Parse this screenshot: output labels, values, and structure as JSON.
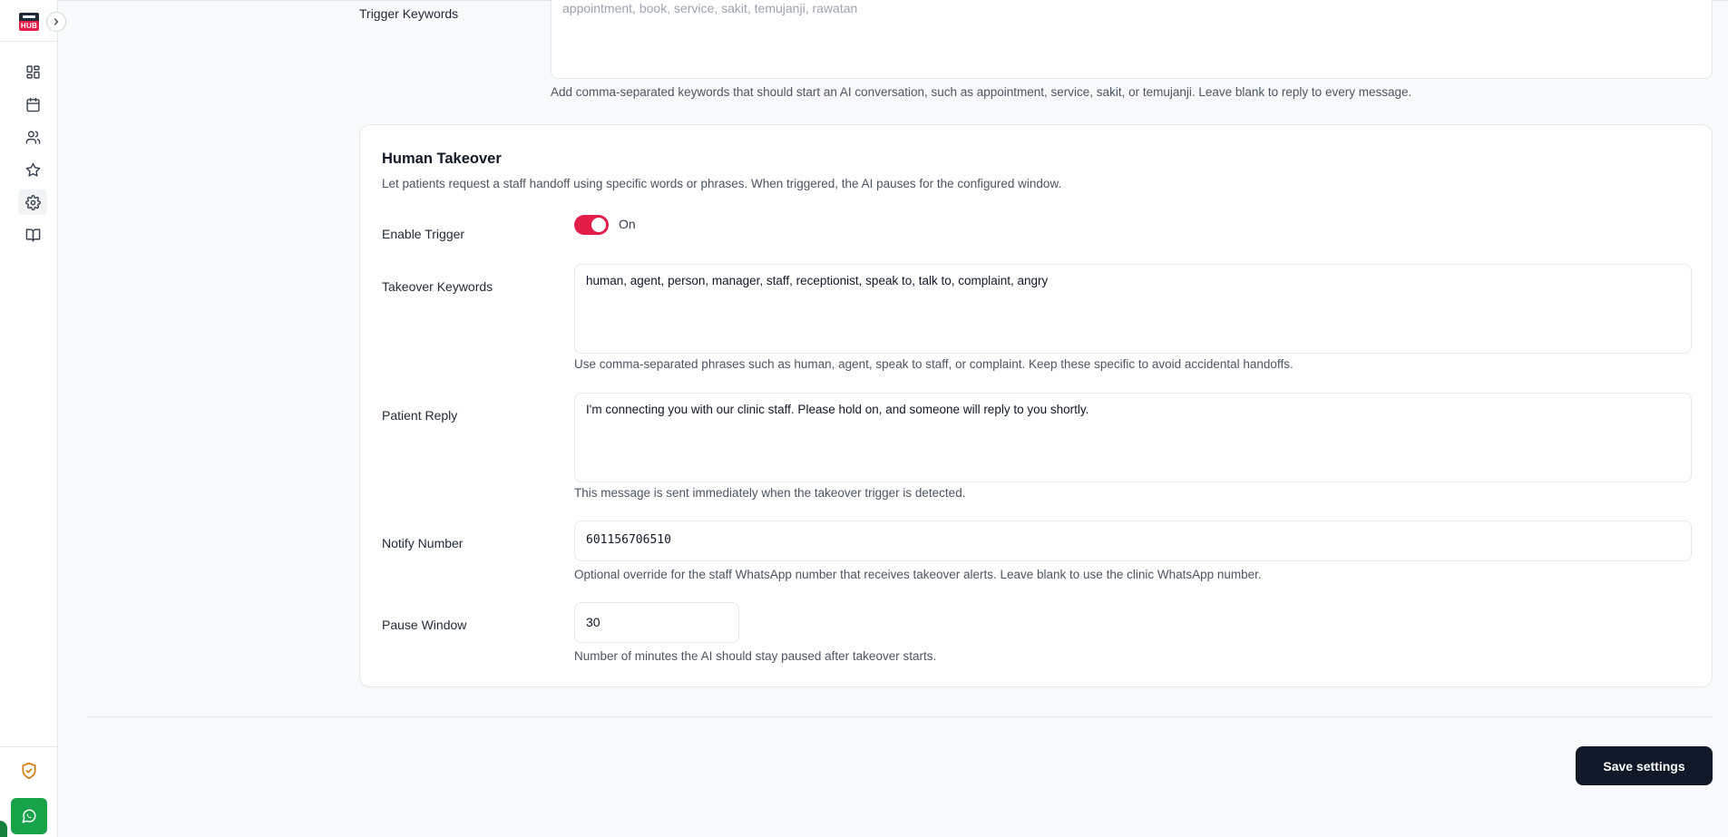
{
  "logo": {
    "text": "HUB"
  },
  "sidebar": {
    "items": [
      {
        "name": "dashboard-icon"
      },
      {
        "name": "calendar-icon"
      },
      {
        "name": "users-icon"
      },
      {
        "name": "star-icon"
      },
      {
        "name": "gear-icon"
      },
      {
        "name": "book-icon"
      }
    ]
  },
  "trigger": {
    "label": "Trigger Keywords",
    "value": "appointment, book, service, sakit, temujanji, rawatan",
    "help": "Add comma-separated keywords that should start an AI conversation, such as appointment, service, sakit, or temujanji. Leave blank to reply to every message."
  },
  "takeover": {
    "title": "Human Takeover",
    "description": "Let patients request a staff handoff using specific words or phrases. When triggered, the AI pauses for the configured window.",
    "enable_label": "Enable Trigger",
    "enable_state": "On",
    "keywords_label": "Takeover Keywords",
    "keywords_value": "human, agent, person, manager, staff, receptionist, speak to, talk to, complaint, angry",
    "keywords_help": "Use comma-separated phrases such as human, agent, speak to staff, or complaint. Keep these specific to avoid accidental handoffs.",
    "reply_label": "Patient Reply",
    "reply_value": "I'm connecting you with our clinic staff. Please hold on, and someone will reply to you shortly.",
    "reply_help": "This message is sent immediately when the takeover trigger is detected.",
    "notify_label": "Notify Number",
    "notify_value": "601156706510",
    "notify_help": "Optional override for the staff WhatsApp number that receives takeover alerts. Leave blank to use the clinic WhatsApp number.",
    "pause_label": "Pause Window",
    "pause_value": "30",
    "pause_help": "Number of minutes the AI should stay paused after takeover starts."
  },
  "actions": {
    "save_label": "Save settings"
  },
  "colors": {
    "accent": "#e11d48",
    "whatsapp": "#16a34a",
    "button": "#111827"
  }
}
